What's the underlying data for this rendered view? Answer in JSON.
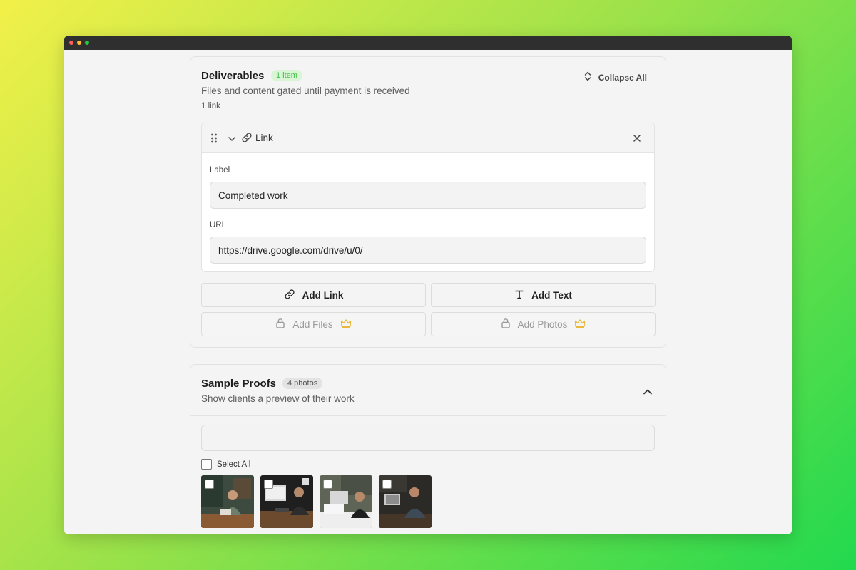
{
  "deliverables": {
    "title": "Deliverables",
    "badge": "1 item",
    "subtitle": "Files and content gated until payment is received",
    "count": "1 link",
    "collapse_label": "Collapse All",
    "item": {
      "type_label": "Link",
      "label_caption": "Label",
      "label_value": "Completed work",
      "url_caption": "URL",
      "url_value": "https://drive.google.com/drive/u/0/"
    },
    "buttons": {
      "add_link": "Add Link",
      "add_text": "Add Text",
      "add_files": "Add Files",
      "add_photos": "Add Photos"
    }
  },
  "proofs": {
    "title": "Sample Proofs",
    "badge": "4 photos",
    "subtitle": "Show clients a preview of their work",
    "search_value": "",
    "select_all_label": "Select All"
  },
  "icons": {
    "drag": "drag-handle-icon",
    "chevron_down": "chevron-down-icon",
    "link": "link-icon",
    "close": "close-icon",
    "text": "text-icon",
    "lock": "lock-icon",
    "crown": "crown-icon",
    "sort": "chevron-up-down-icon",
    "chevron_up": "chevron-up-icon"
  },
  "colors": {
    "badge_green_bg": "#d9f5d6",
    "badge_green_text": "#3fbf45",
    "crown": "#e8b93a"
  }
}
